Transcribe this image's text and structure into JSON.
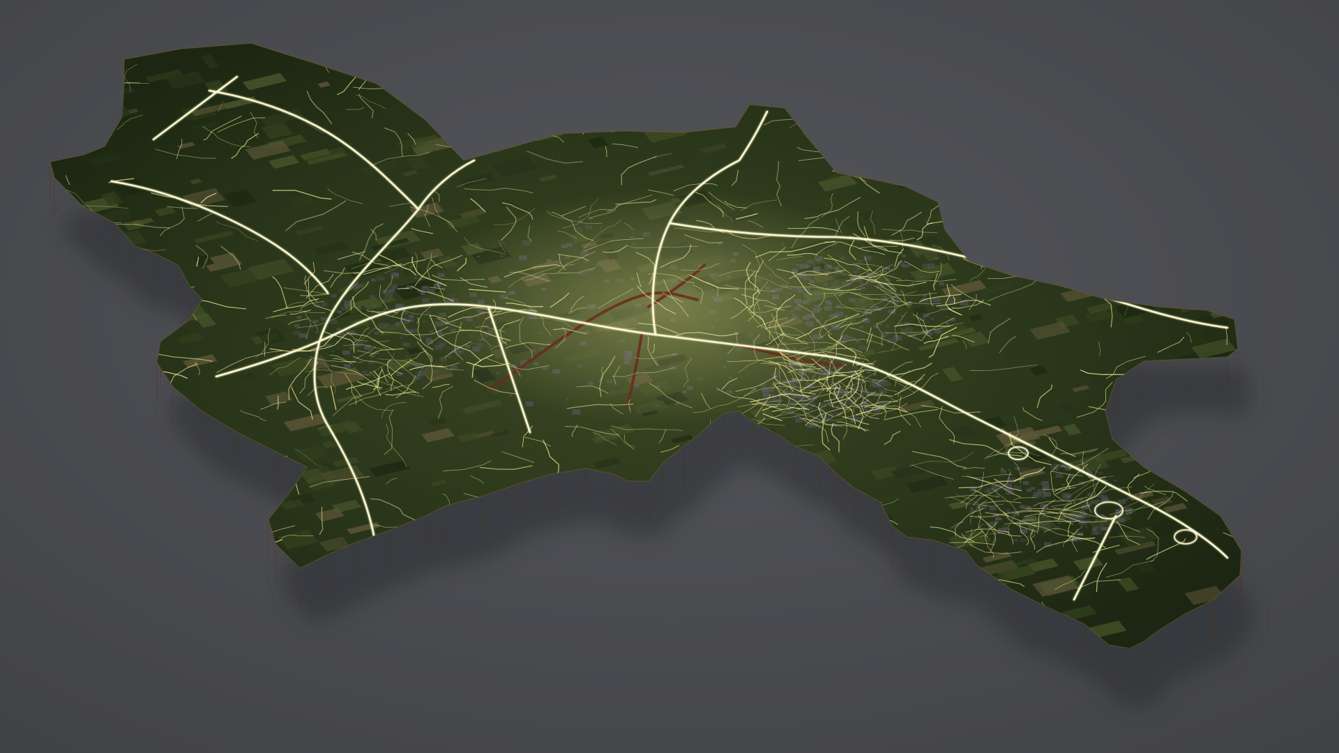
{
  "colors": {
    "background": "#4b4c51",
    "background_glow": "#55565b",
    "terrain_dark": "#1d2812",
    "terrain_mid": "#2f3d1c",
    "terrain_light": "#47552b",
    "field_tan": "#5a5536",
    "urban_gray": "#4f5055",
    "side_wall_top": "#b4552a",
    "side_wall_bottom": "#4a2410",
    "road_glow": "#f4ef9a",
    "road_core": "#fffbd2",
    "river": "#6b2a1c"
  },
  "map": {
    "style": "3d-extruded-region",
    "roads_visible": true,
    "satellite_texture": true,
    "labels_visible": false
  }
}
